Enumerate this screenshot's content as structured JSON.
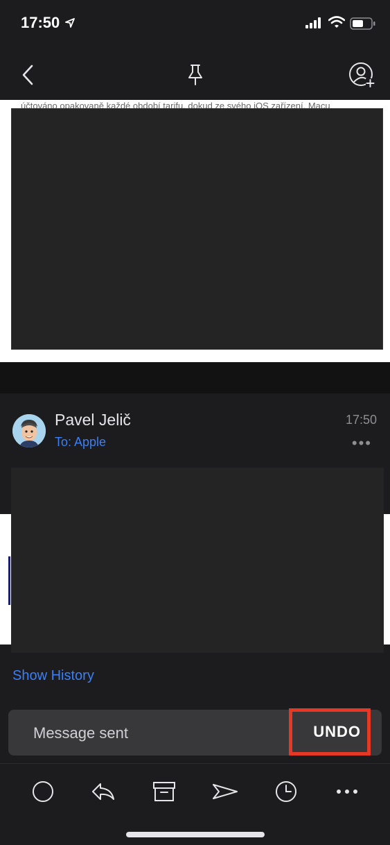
{
  "status_bar": {
    "time": "17:50"
  },
  "message_1": {
    "snippet": "účtováno opakovaně každé období tarifu, dokud ze svého iOS zařízení, Macu"
  },
  "message_2": {
    "sender": "Pavel Jelič",
    "recipient": "To: Apple",
    "time": "17:50",
    "more": "•••",
    "show_history": "Show History"
  },
  "toast": {
    "text": "Message sent",
    "undo": "UNDO"
  },
  "icons": {
    "back": "chevron-left-icon",
    "pin": "pin-icon",
    "add_person": "add-person-icon",
    "mark": "circle-icon",
    "reply": "reply-icon",
    "archive": "archive-icon",
    "forward": "forward-icon",
    "snooze": "clock-icon",
    "more": "more-icon"
  },
  "colors": {
    "accent": "#3d7ff5",
    "highlight": "#e53925",
    "background": "#1c1c1e"
  }
}
